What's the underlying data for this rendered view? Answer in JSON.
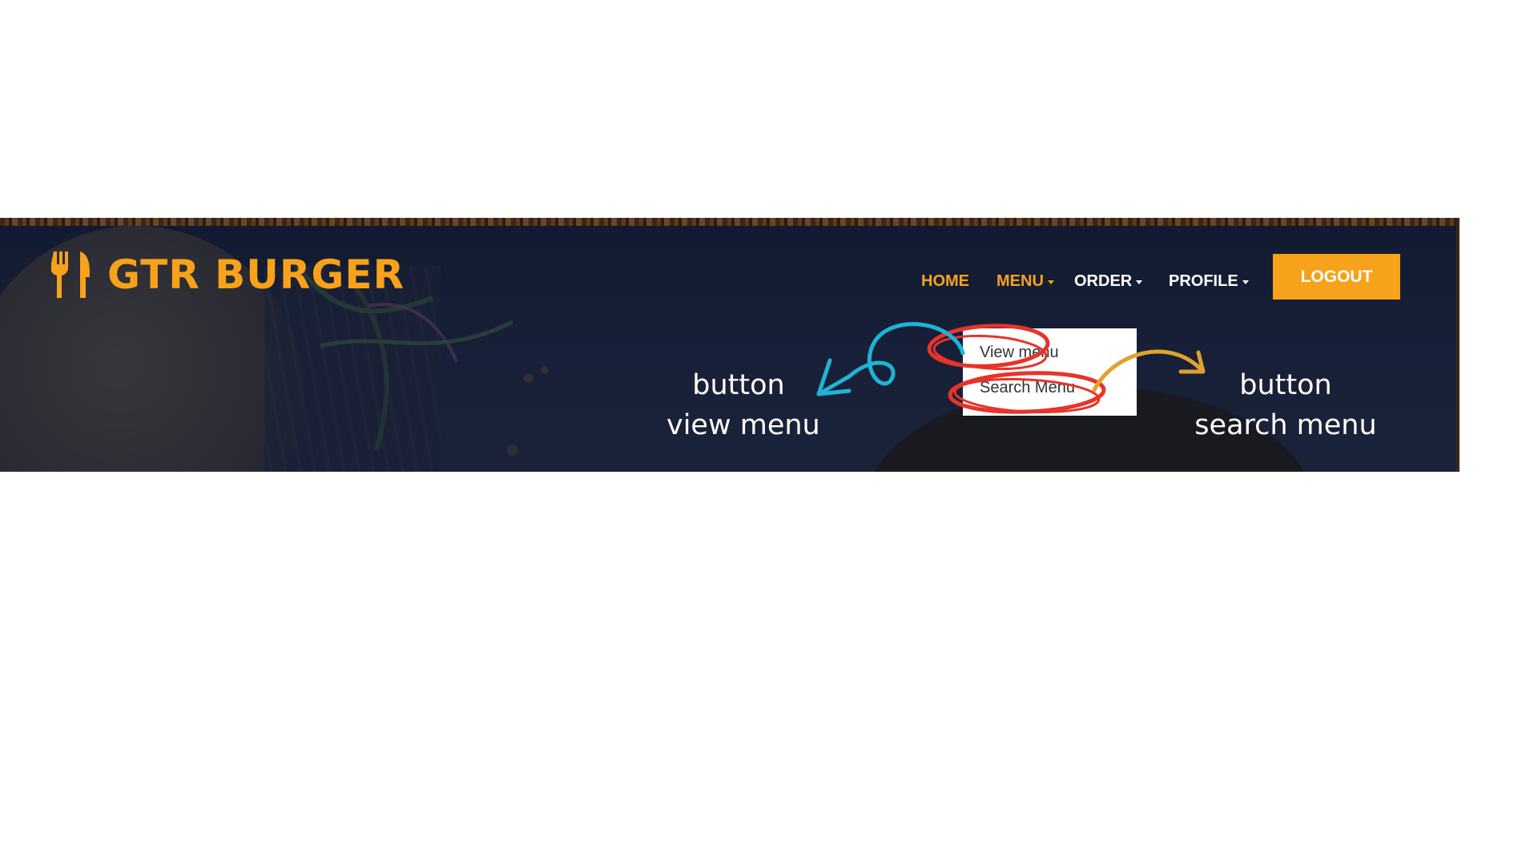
{
  "app": {
    "brand": "GTR BURGER"
  },
  "nav": {
    "items": [
      {
        "label": "HOME",
        "active": true,
        "has_dropdown": false
      },
      {
        "label": "MENU",
        "active": true,
        "has_dropdown": true
      },
      {
        "label": "ORDER",
        "active": false,
        "has_dropdown": true
      },
      {
        "label": "PROFILE",
        "active": false,
        "has_dropdown": true
      }
    ],
    "logout_label": "LOGOUT"
  },
  "menu_dropdown": {
    "items": [
      {
        "label": "View menu"
      },
      {
        "label": "Search Menu"
      }
    ]
  },
  "annotations": {
    "left": {
      "line1": "button",
      "line2": "view menu"
    },
    "right": {
      "line1": "button",
      "line2": "search menu"
    }
  },
  "icons": {
    "logo": "fork-knife-icon",
    "caret": "chevron-down-icon"
  },
  "colors": {
    "accent": "#f7a21b",
    "header_bg": "#172038",
    "nav_text": "#ffffff",
    "highlight_circle": "#e8332a",
    "arrow_left": "#1fb3d6",
    "arrow_right": "#e0a12e",
    "page_bg": "#ffffff"
  }
}
